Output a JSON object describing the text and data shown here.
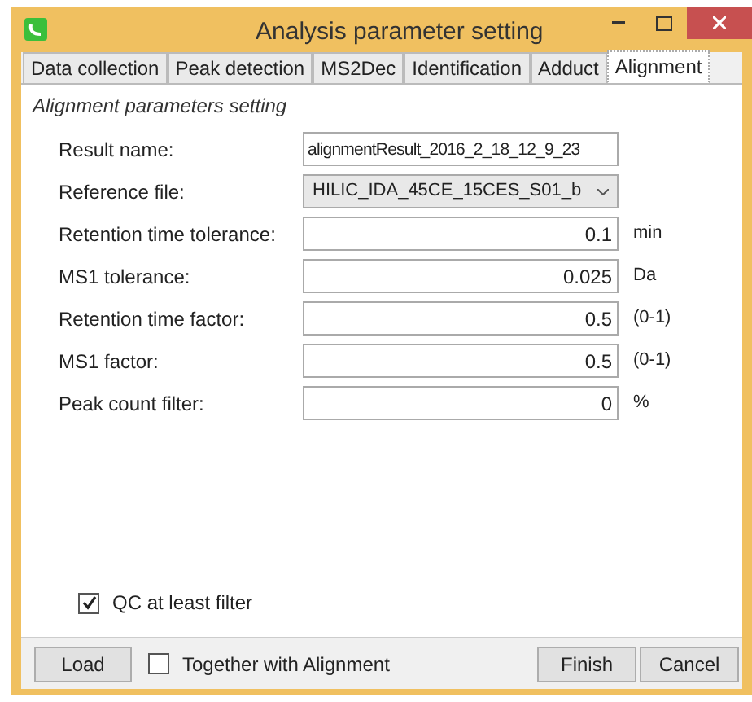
{
  "window": {
    "title": "Analysis parameter setting"
  },
  "tabs": [
    {
      "label": "Data collection",
      "selected": false
    },
    {
      "label": "Peak detection",
      "selected": false
    },
    {
      "label": "MS2Dec",
      "selected": false
    },
    {
      "label": "Identification",
      "selected": false
    },
    {
      "label": "Adduct",
      "selected": false
    },
    {
      "label": "Alignment",
      "selected": true
    }
  ],
  "section_title": "Alignment parameters setting",
  "fields": [
    {
      "kind": "text",
      "label": "Result name:",
      "value": "alignmentResult_2016_2_18_12_9_23"
    },
    {
      "kind": "dropdown",
      "label": "Reference file:",
      "value": "HILIC_IDA_45CE_15CES_S01_b"
    },
    {
      "kind": "number",
      "label": "Retention time tolerance:",
      "value": "0.1",
      "unit": "min"
    },
    {
      "kind": "number",
      "label": "MS1 tolerance:",
      "value": "0.025",
      "unit": "Da"
    },
    {
      "kind": "number",
      "label": "Retention time factor:",
      "value": "0.5",
      "unit": "(0-1)"
    },
    {
      "kind": "number",
      "label": "MS1 factor:",
      "value": "0.5",
      "unit": "(0-1)"
    },
    {
      "kind": "number",
      "label": "Peak count filter:",
      "value": "0",
      "unit": "%"
    }
  ],
  "qc_filter": {
    "label": "QC at least filter",
    "checked": true
  },
  "footer": {
    "load": "Load",
    "together": {
      "label": "Together with Alignment",
      "checked": false
    },
    "finish": "Finish",
    "cancel": "Cancel"
  }
}
